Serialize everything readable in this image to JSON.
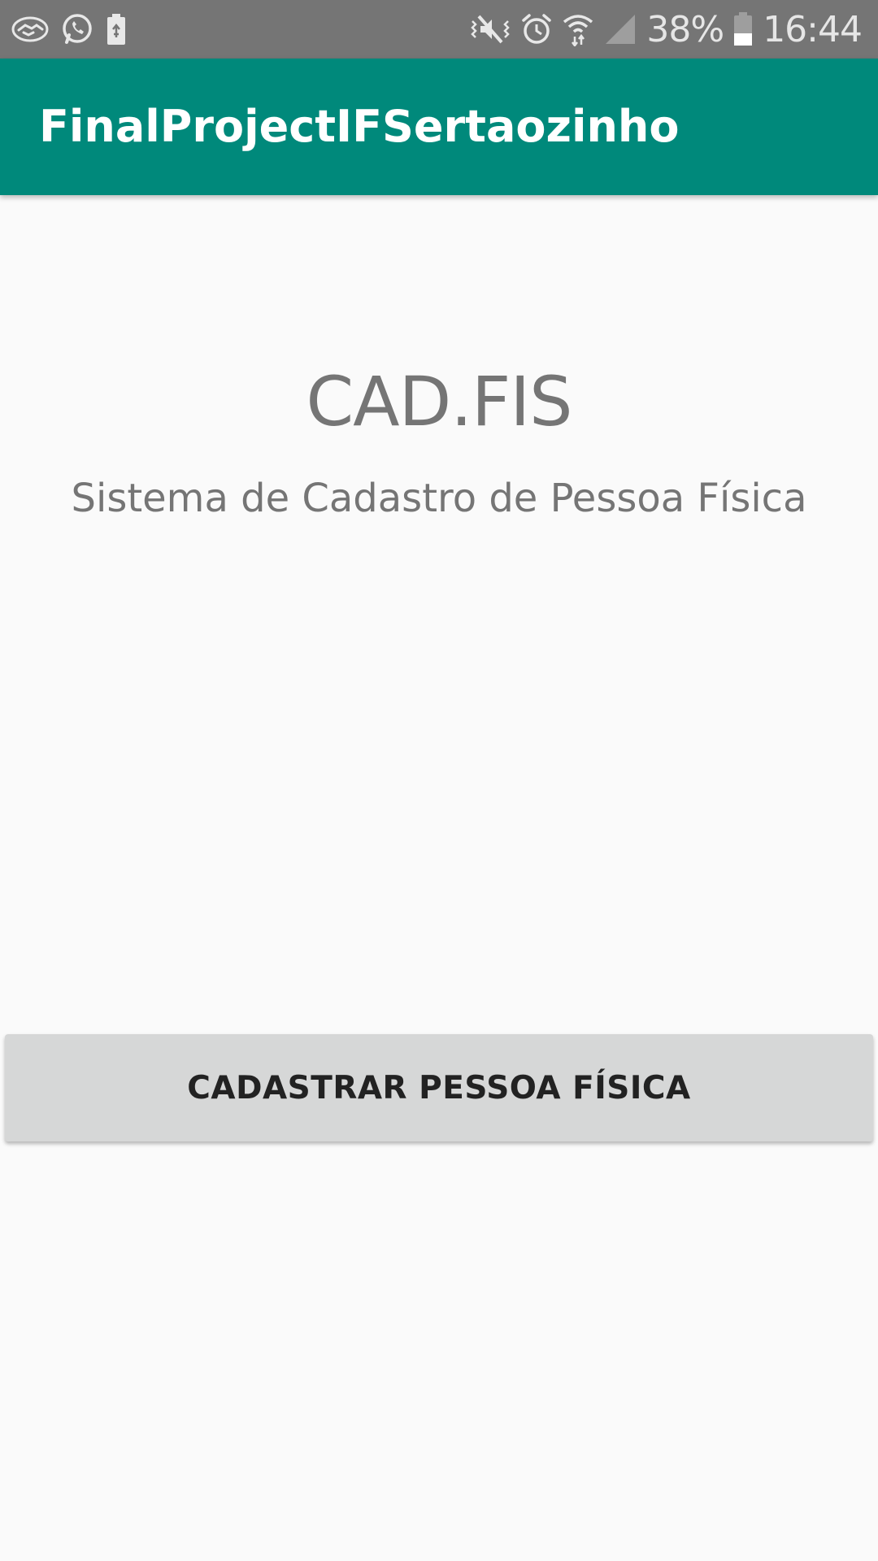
{
  "status_bar": {
    "left_icons": [
      "handshake-icon",
      "whatsapp-icon",
      "battery-saver-icon"
    ],
    "right_icons": [
      "vibrate-mute-icon",
      "alarm-icon",
      "wifi-icon",
      "signal-icon",
      "battery-icon"
    ],
    "battery_percent": "38%",
    "time": "16:44"
  },
  "app_bar": {
    "title": "FinalProjectIFSertaozinho",
    "color": "#00897b"
  },
  "main": {
    "app_name": "CAD.FIS",
    "subtitle": "Sistema de Cadastro de Pessoa Física",
    "primary_button_label": "CADASTRAR PESSOA FÍSICA"
  }
}
